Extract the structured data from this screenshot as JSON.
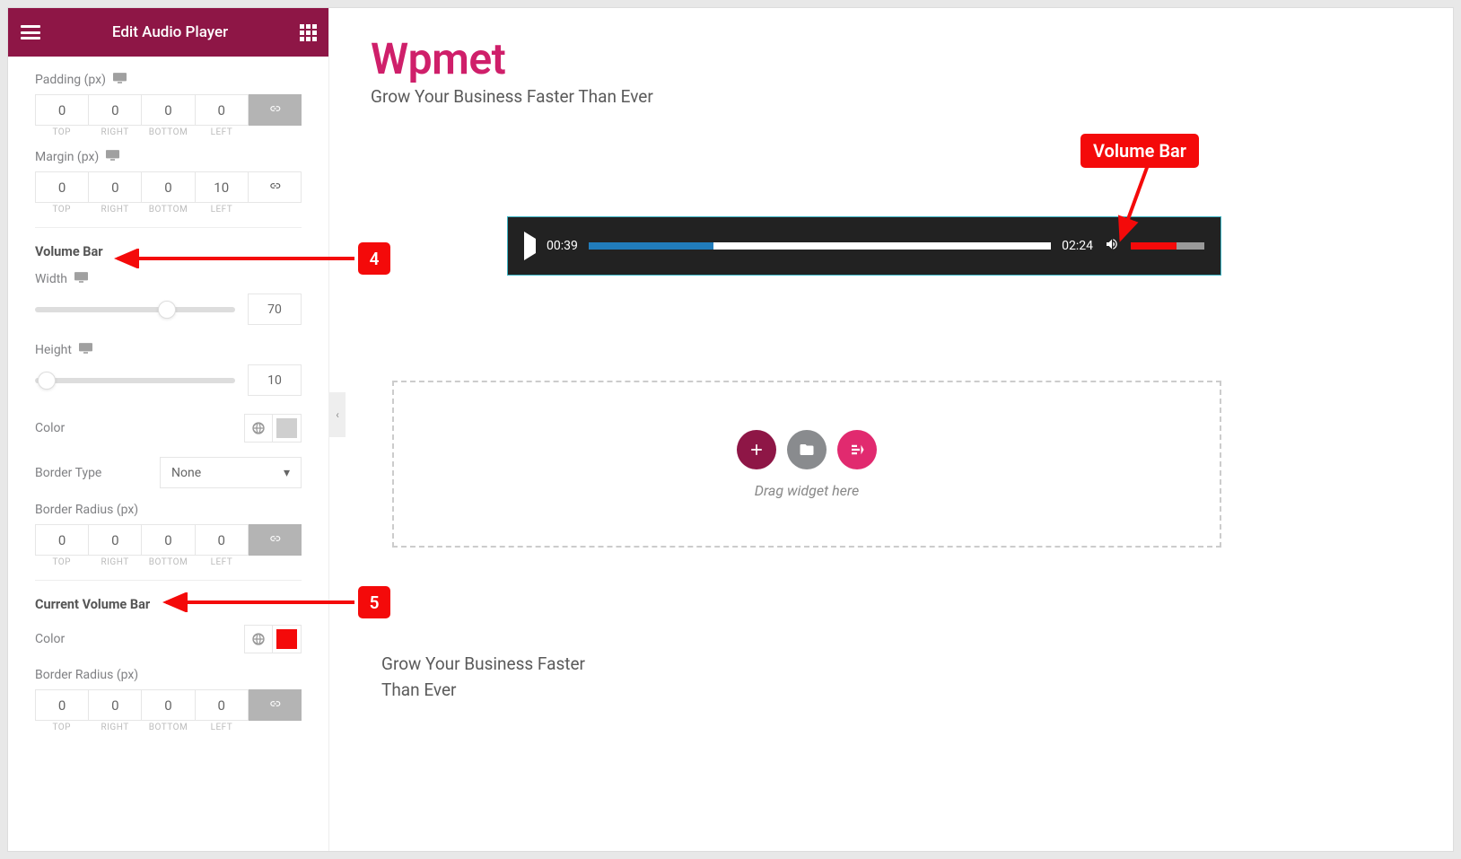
{
  "header": {
    "title": "Edit Audio Player"
  },
  "spacing": {
    "padding": {
      "label": "Padding (px)",
      "top": "0",
      "right": "0",
      "bottom": "0",
      "left": "0",
      "labels": [
        "TOP",
        "RIGHT",
        "BOTTOM",
        "LEFT"
      ],
      "linked": true
    },
    "margin": {
      "label": "Margin (px)",
      "top": "0",
      "right": "0",
      "bottom": "0",
      "left": "10",
      "labels": [
        "TOP",
        "RIGHT",
        "BOTTOM",
        "LEFT"
      ],
      "linked": false
    }
  },
  "volume_bar_section": {
    "heading": "Volume Bar",
    "width": {
      "label": "Width",
      "value": "70",
      "thumb_pct": 66
    },
    "height": {
      "label": "Height",
      "value": "10",
      "thumb_pct": 6
    },
    "color": {
      "label": "Color",
      "swatch": "#cfcfcf"
    },
    "border_type": {
      "label": "Border Type",
      "value": "None"
    },
    "border_radius": {
      "label": "Border Radius (px)",
      "top": "0",
      "right": "0",
      "bottom": "0",
      "left": "0",
      "labels": [
        "TOP",
        "RIGHT",
        "BOTTOM",
        "LEFT"
      ],
      "linked": true
    }
  },
  "current_volume_bar_section": {
    "heading": "Current Volume Bar",
    "color": {
      "label": "Color",
      "swatch": "#f40a0a"
    },
    "border_radius": {
      "label": "Border Radius (px)",
      "top": "0",
      "right": "0",
      "bottom": "0",
      "left": "0",
      "labels": [
        "TOP",
        "RIGHT",
        "BOTTOM",
        "LEFT"
      ],
      "linked": true
    }
  },
  "preview": {
    "brand_title": "Wpmet",
    "brand_sub": "Grow Your Business Faster Than Ever",
    "audio": {
      "current_time": "00:39",
      "total_time": "02:24",
      "progress_pct": 27,
      "volume_pct": 62
    },
    "drop_hint": "Drag widget here",
    "sub_text": "Grow Your Business Faster Than Ever"
  },
  "annotations": {
    "volume_bar_label": "Volume Bar",
    "badge4": "4",
    "badge5": "5"
  },
  "colors": {
    "accent": "#8e1646",
    "brand": "#cf1f6a",
    "red": "#f40a0a",
    "progress": "#217cbb",
    "circ_plus": "#8e1646",
    "circ_folder": "#898b8e",
    "circ_ek": "#e12a6f"
  }
}
